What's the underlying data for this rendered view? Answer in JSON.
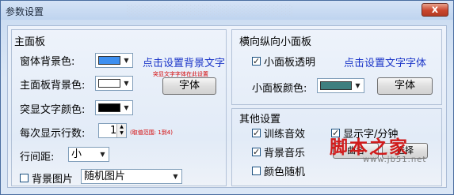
{
  "window": {
    "title": "参数设置",
    "close_label": "x"
  },
  "main_panel": {
    "title": "主面板",
    "window_bg": {
      "label": "窗体背景色:",
      "color": "#3d8ff0"
    },
    "set_bg_text_link": "点击设置背景文字",
    "panel_bg": {
      "label": "主面板背景色:",
      "color": "#ffffff"
    },
    "bg_text_hint": "突显文字字体在此设置",
    "font_button": "字体",
    "highlight": {
      "label": "突显文字颜色:",
      "color": "#000000"
    },
    "rows": {
      "label": "每次显示行数:",
      "value": "1",
      "range_hint": "(取值范围: 1到4)"
    },
    "line_spacing": {
      "label": "行间距:",
      "value": "小"
    },
    "bg_image": {
      "label": "背景图片",
      "checked": false,
      "value": "随机图片"
    }
  },
  "mini_panel": {
    "title": "横向纵向小面板",
    "transparent": {
      "label": "小面板透明",
      "checked": true
    },
    "set_text_font_link": "点击设置文字字体",
    "color": {
      "label": "小面板颜色:",
      "color": "#3e7f7f"
    },
    "font_button": "字体"
  },
  "other": {
    "title": "其他设置",
    "training_sound": {
      "label": "训练音效",
      "checked": true
    },
    "show_wpm": {
      "label": "显示字/分钟",
      "checked": true
    },
    "bg_music": {
      "label": "背景音乐",
      "checked": true
    },
    "music_name_button": "曲名",
    "music_select_button": "选择",
    "color_random": {
      "label": "颜色随机",
      "checked": false
    }
  },
  "watermark": {
    "site_name": "脚本之家",
    "site_url": "www.jb51.net"
  }
}
